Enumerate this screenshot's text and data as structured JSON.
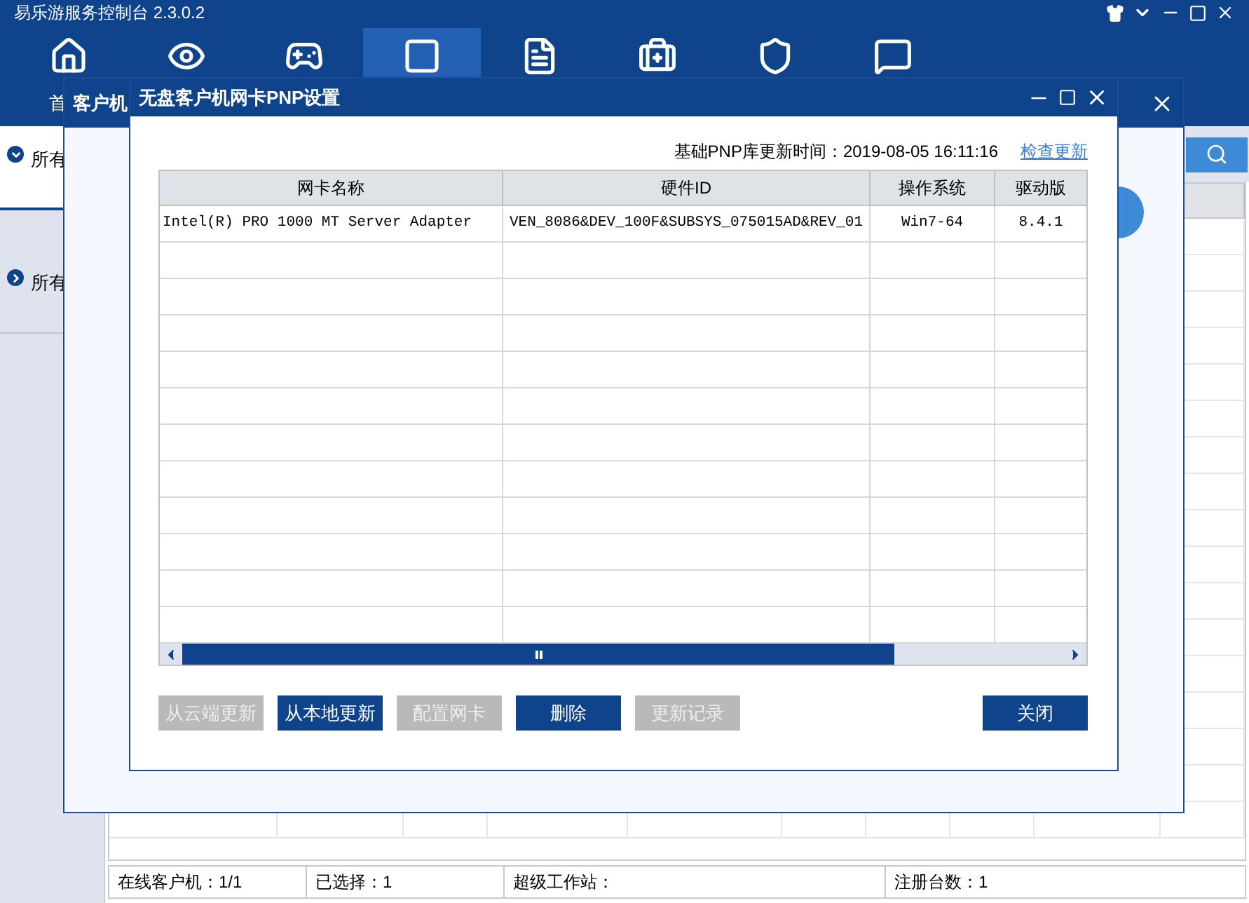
{
  "app": {
    "title": "易乐游服务控制台 2.3.0.2",
    "nav": [
      {
        "label": "首",
        "selected": false
      },
      {
        "selected": false
      },
      {
        "selected": false
      },
      {
        "selected": true
      },
      {
        "selected": false
      },
      {
        "selected": false
      },
      {
        "selected": false
      },
      {
        "selected": false
      }
    ]
  },
  "sidebar": [
    {
      "label": "所有",
      "expanded": true,
      "selected": true
    },
    {
      "label": "所有",
      "expanded": false,
      "selected": false
    }
  ],
  "status_bar": [
    "在线客户机：1/1",
    "已选择：1",
    "超级工作站：",
    "注册台数：1"
  ],
  "outer_dialog": {
    "title": "客户机"
  },
  "dialog": {
    "title": "无盘客户机网卡PNP设置",
    "update_label": "基础PNP库更新时间：2019-08-05 16:11:16",
    "check_link": "检查更新",
    "table": {
      "columns": [
        "网卡名称",
        "硬件ID",
        "操作系统",
        "驱动版"
      ],
      "rows": [
        [
          "Intel(R) PRO 1000 MT Server Adapter",
          "VEN_8086&DEV_100F&SUBSYS_075015AD&REV_01",
          "Win7-64",
          "8.4.1"
        ]
      ]
    },
    "buttons": [
      {
        "label": "从云端更新",
        "disabled": true
      },
      {
        "label": "从本地更新",
        "disabled": false
      },
      {
        "label": "配置网卡",
        "disabled": true
      },
      {
        "label": "删除",
        "disabled": false
      },
      {
        "label": "更新记录",
        "disabled": true
      }
    ],
    "close_button": "关闭"
  }
}
